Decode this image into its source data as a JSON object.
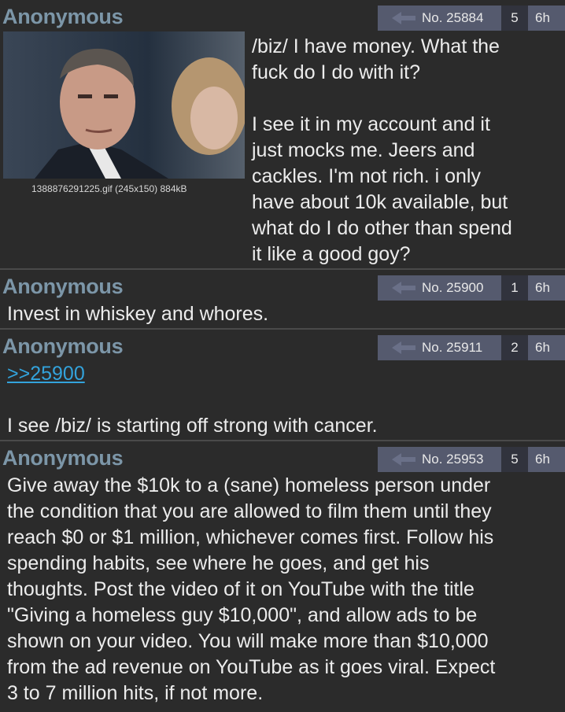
{
  "posts": [
    {
      "name": "Anonymous",
      "number": "No. 25884",
      "replies": "5",
      "age": "6h",
      "file_info": "1388876291225.gif (245x150) 884kB",
      "body": "/biz/ I have money. What the\nfuck do I do with it?\n\nI see it in my account and it\njust mocks me. Jeers and\ncackles. I'm not rich. i only\nhave about 10k available, but\nwhat do I do other than spend\nit like a good goy?"
    },
    {
      "name": "Anonymous",
      "number": "No. 25900",
      "replies": "1",
      "age": "6h",
      "body": "Invest in whiskey and whores."
    },
    {
      "name": "Anonymous",
      "number": "No. 25911",
      "replies": "2",
      "age": "6h",
      "quote_link": ">>25900",
      "body": "I see /biz/ is starting off strong with cancer."
    },
    {
      "name": "Anonymous",
      "number": "No. 25953",
      "replies": "5",
      "age": "6h",
      "body": "Give away the $10k to a (sane) homeless person under\nthe condition that you are allowed to film them until they\nreach $0 or $1 million, whichever comes first. Follow his\nspending habits, see where he goes, and get his\nthoughts. Post the video of it on YouTube with the title\n\"Giving a homeless guy $10,000\", and allow ads to be\nshown on your video. You will make more than $10,000\nfrom the ad revenue on YouTube as it goes viral. Expect\n3 to 7 million hits, if not more."
    }
  ],
  "colors": {
    "background": "#2b2b2b",
    "name": "#7c96a8",
    "meta_bar": "#555a6e",
    "link": "#33a3dc"
  },
  "icons": {
    "reply": "reply-arrow-icon"
  }
}
